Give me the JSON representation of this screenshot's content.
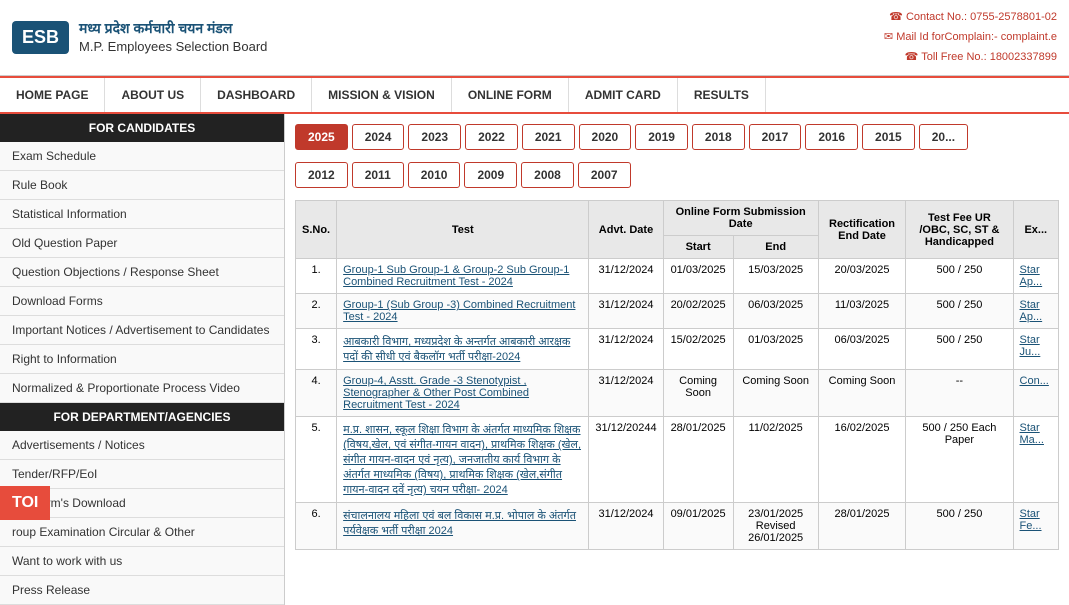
{
  "header": {
    "logo": "ESB",
    "org_hindi": "मध्य प्रदेश कर्मचारी चयन मंडल",
    "org_english": "M.P. Employees Selection Board",
    "contact1": "Contact No.: 0755-2578801-02",
    "contact2": "Mail Id forComplain:- complaint.e",
    "contact3": "Toll Free No.: 18002337899"
  },
  "nav": {
    "items": [
      {
        "label": "HOME PAGE"
      },
      {
        "label": "ABOUT US"
      },
      {
        "label": "DASHBOARD"
      },
      {
        "label": "MISSION & VISION"
      },
      {
        "label": "ONLINE FORM"
      },
      {
        "label": "ADMIT CARD"
      },
      {
        "label": "RESULTS"
      }
    ]
  },
  "sidebar": {
    "section1_title": "FOR CANDIDATES",
    "items1": [
      "Exam Schedule",
      "Rule Book",
      "Statistical Information",
      "Old Question Paper",
      "Question Objections / Response Sheet",
      "Download Forms",
      "Important Notices / Advertisement to Candidates",
      "Right to Information",
      "Normalized & Proportionate Process Video"
    ],
    "section2_title": "FOR DEPARTMENT/AGENCIES",
    "items2": [
      "Advertisements / Notices",
      "Tender/RFP/EoI",
      "s & Form's Download",
      "roup Examination Circular & Other",
      "Want to work with us",
      "Press Release"
    ]
  },
  "years_row1": [
    "2025",
    "2024",
    "2023",
    "2022",
    "2021",
    "2020",
    "2019",
    "2018",
    "2017",
    "2016",
    "2015",
    "20..."
  ],
  "years_row2": [
    "2012",
    "2011",
    "2010",
    "2009",
    "2008",
    "2007"
  ],
  "table": {
    "headers": {
      "sno": "S.No.",
      "test": "Test",
      "advt_date": "Advt. Date",
      "online_form_start": "Start",
      "online_form_end": "End",
      "online_form_header": "Online Form Submission Date",
      "rectification_end_date": "Rectification End Date",
      "test_fee": "Test Fee UR /OBC, SC, ST & Handicapped",
      "exam": "Ex..."
    },
    "rows": [
      {
        "sno": "1.",
        "test": "Group-1 Sub Group-1 & Group-2 Sub Group-1 Combined Recruitment Test - 2024",
        "advt_date": "31/12/2024",
        "start": "01/03/2025",
        "end": "15/03/2025",
        "rectification": "20/03/2025",
        "fee": "500 / 250",
        "exam": "Star Ap..."
      },
      {
        "sno": "2.",
        "test": "Group-1 (Sub Group -3) Combined Recruitment Test - 2024",
        "advt_date": "31/12/2024",
        "start": "20/02/2025",
        "end": "06/03/2025",
        "rectification": "11/03/2025",
        "fee": "500 / 250",
        "exam": "Star Ap..."
      },
      {
        "sno": "3.",
        "test": "आबकारी विभाग, मध्यप्रदेश के अन्तर्गत आबकारी आरक्षक पदों की सीधी एवं बैकलॉग भर्ती परीक्षा-2024",
        "advt_date": "31/12/2024",
        "start": "15/02/2025",
        "end": "01/03/2025",
        "rectification": "06/03/2025",
        "fee": "500 / 250",
        "exam": "Star Ju..."
      },
      {
        "sno": "4.",
        "test": "Group-4, Asstt. Grade -3 Stenotypist , Stenographer & Other Post Combined Recruitment Test - 2024",
        "advt_date": "31/12/2024",
        "start": "Coming Soon",
        "end": "Coming Soon",
        "rectification": "Coming Soon",
        "fee": "--",
        "exam": "Con..."
      },
      {
        "sno": "5.",
        "test": "म.प्र. शासन, स्कूल शिक्षा विभाग के अंतर्गत माध्यमिक शिक्षक (विषय,खेल, एवं संगीत-गायन वादन), प्राथमिक शिक्षक (खेल, संगीत गायन-वादन एवं नृत्य), जनजातीय कार्य विभाग के अंतर्गत माध्यमिक (विषय), प्राथमिक शिक्षक (खेल,संगीत  गायन-वादन दवें  नृत्य) चयन परीक्षा- 2024",
        "advt_date": "31/12/20244",
        "start": "28/01/2025",
        "end": "11/02/2025",
        "rectification": "16/02/2025",
        "fee": "500 / 250 Each Paper",
        "exam": "Star Ma..."
      },
      {
        "sno": "6.",
        "test": "संचालनालय महिला एवं बल विकास म.प्र. भोपाल के अंतर्गत पर्यवेक्षक भर्ती परीक्षा 2024",
        "advt_date": "31/12/2024",
        "start": "09/01/2025",
        "end": "23/01/2025 Revised 26/01/2025",
        "rectification": "28/01/2025",
        "fee": "500 / 250",
        "exam": "Star Fe..."
      }
    ]
  },
  "toi": "TOI"
}
